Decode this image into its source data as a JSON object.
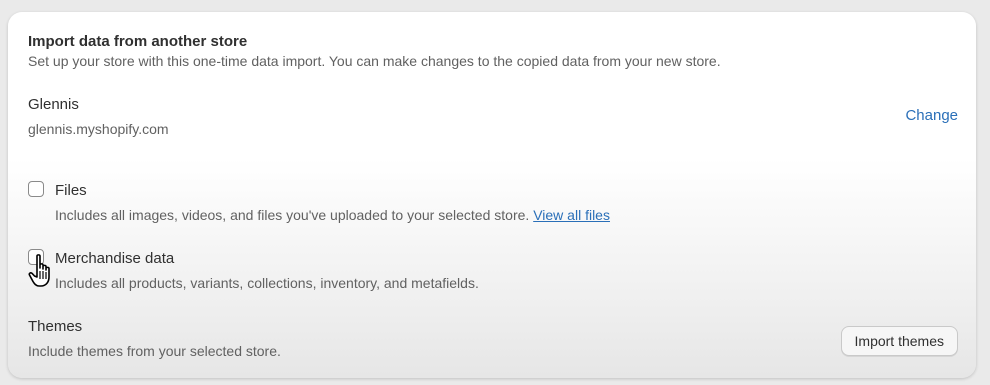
{
  "section": {
    "title": "Import data from another store",
    "subtitle": "Set up your store with this one-time data import. You can make changes to the copied data from your new store."
  },
  "store": {
    "name": "Glennis",
    "url": "glennis.myshopify.com",
    "change_label": "Change"
  },
  "options": [
    {
      "label": "Files",
      "description": "Includes all images, videos, and files you've uploaded to your selected store.",
      "link": "View all files",
      "checked": false
    },
    {
      "label": "Merchandise data",
      "description": "Includes all products, variants, collections, inventory, and metafields.",
      "checked": false
    }
  ],
  "themes": {
    "label": "Themes",
    "description": "Include themes from your selected store.",
    "button_label": "Import themes"
  },
  "colors": {
    "link": "#2a6fb8",
    "text": "#303030",
    "muted": "#616161"
  }
}
